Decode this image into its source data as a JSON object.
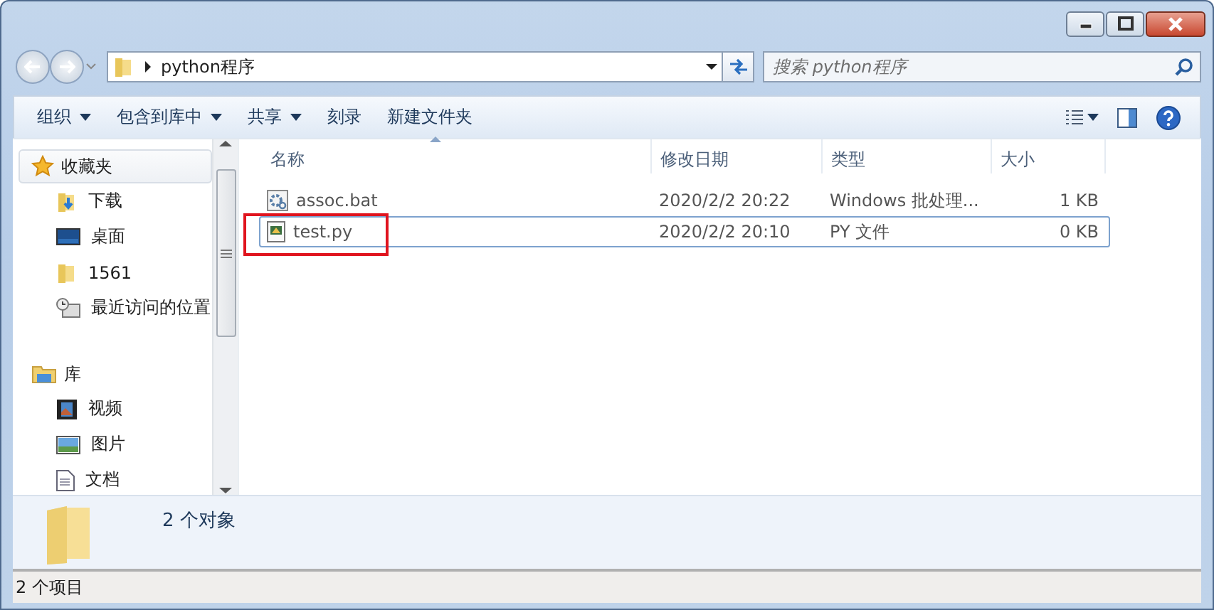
{
  "address_bar": {
    "path": "python程序",
    "search_placeholder": "搜索 python程序"
  },
  "toolbar": {
    "items": [
      {
        "label": "组织",
        "dropdown": true
      },
      {
        "label": "包含到库中",
        "dropdown": true
      },
      {
        "label": "共享",
        "dropdown": true
      },
      {
        "label": "刻录",
        "dropdown": false
      },
      {
        "label": "新建文件夹",
        "dropdown": false
      }
    ]
  },
  "sidebar": {
    "groups": [
      {
        "label": "收藏夹",
        "selected": true,
        "children": [
          {
            "label": "下载",
            "selected": false
          },
          {
            "label": "桌面",
            "selected": false
          },
          {
            "label": "1561",
            "selected": false
          },
          {
            "label": "最近访问的位置",
            "selected": false
          }
        ]
      },
      {
        "label": "库",
        "selected": false,
        "children": [
          {
            "label": "视频",
            "selected": false
          },
          {
            "label": "图片",
            "selected": false
          },
          {
            "label": "文档",
            "selected": false
          }
        ]
      }
    ]
  },
  "table": {
    "columns": [
      {
        "label": "名称",
        "sorted": true
      },
      {
        "label": "修改日期",
        "sorted": false
      },
      {
        "label": "类型",
        "sorted": false
      },
      {
        "label": "大小",
        "sorted": false
      }
    ],
    "rows": [
      {
        "name": "assoc.bat",
        "modified": "2020/2/2 20:22",
        "type": "Windows 批处理...",
        "size": "1 KB",
        "selected": false,
        "highlighted": false
      },
      {
        "name": "test.py",
        "modified": "2020/2/2 20:10",
        "type": "PY 文件",
        "size": "0 KB",
        "selected": true,
        "highlighted": true
      }
    ]
  },
  "details_pane": {
    "summary": "2 个对象"
  },
  "status_bar": {
    "text": "2 个项目"
  }
}
